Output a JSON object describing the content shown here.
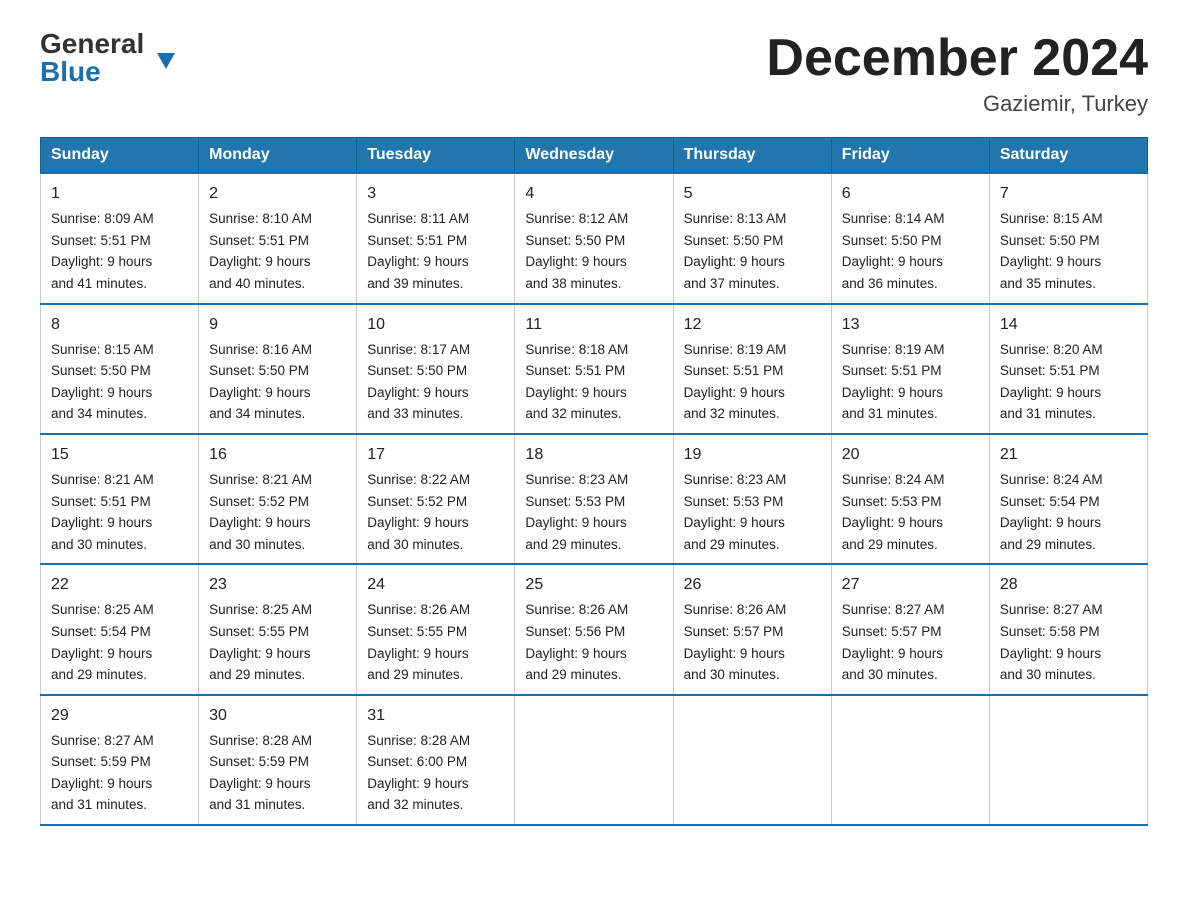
{
  "header": {
    "logo": {
      "general": "General",
      "blue": "Blue",
      "triangle": true
    },
    "title": "December 2024",
    "location": "Gaziemir, Turkey"
  },
  "calendar": {
    "days_of_week": [
      "Sunday",
      "Monday",
      "Tuesday",
      "Wednesday",
      "Thursday",
      "Friday",
      "Saturday"
    ],
    "weeks": [
      [
        {
          "day": "1",
          "sunrise": "8:09 AM",
          "sunset": "5:51 PM",
          "daylight": "9 hours and 41 minutes."
        },
        {
          "day": "2",
          "sunrise": "8:10 AM",
          "sunset": "5:51 PM",
          "daylight": "9 hours and 40 minutes."
        },
        {
          "day": "3",
          "sunrise": "8:11 AM",
          "sunset": "5:51 PM",
          "daylight": "9 hours and 39 minutes."
        },
        {
          "day": "4",
          "sunrise": "8:12 AM",
          "sunset": "5:50 PM",
          "daylight": "9 hours and 38 minutes."
        },
        {
          "day": "5",
          "sunrise": "8:13 AM",
          "sunset": "5:50 PM",
          "daylight": "9 hours and 37 minutes."
        },
        {
          "day": "6",
          "sunrise": "8:14 AM",
          "sunset": "5:50 PM",
          "daylight": "9 hours and 36 minutes."
        },
        {
          "day": "7",
          "sunrise": "8:15 AM",
          "sunset": "5:50 PM",
          "daylight": "9 hours and 35 minutes."
        }
      ],
      [
        {
          "day": "8",
          "sunrise": "8:15 AM",
          "sunset": "5:50 PM",
          "daylight": "9 hours and 34 minutes."
        },
        {
          "day": "9",
          "sunrise": "8:16 AM",
          "sunset": "5:50 PM",
          "daylight": "9 hours and 34 minutes."
        },
        {
          "day": "10",
          "sunrise": "8:17 AM",
          "sunset": "5:50 PM",
          "daylight": "9 hours and 33 minutes."
        },
        {
          "day": "11",
          "sunrise": "8:18 AM",
          "sunset": "5:51 PM",
          "daylight": "9 hours and 32 minutes."
        },
        {
          "day": "12",
          "sunrise": "8:19 AM",
          "sunset": "5:51 PM",
          "daylight": "9 hours and 32 minutes."
        },
        {
          "day": "13",
          "sunrise": "8:19 AM",
          "sunset": "5:51 PM",
          "daylight": "9 hours and 31 minutes."
        },
        {
          "day": "14",
          "sunrise": "8:20 AM",
          "sunset": "5:51 PM",
          "daylight": "9 hours and 31 minutes."
        }
      ],
      [
        {
          "day": "15",
          "sunrise": "8:21 AM",
          "sunset": "5:51 PM",
          "daylight": "9 hours and 30 minutes."
        },
        {
          "day": "16",
          "sunrise": "8:21 AM",
          "sunset": "5:52 PM",
          "daylight": "9 hours and 30 minutes."
        },
        {
          "day": "17",
          "sunrise": "8:22 AM",
          "sunset": "5:52 PM",
          "daylight": "9 hours and 30 minutes."
        },
        {
          "day": "18",
          "sunrise": "8:23 AM",
          "sunset": "5:53 PM",
          "daylight": "9 hours and 29 minutes."
        },
        {
          "day": "19",
          "sunrise": "8:23 AM",
          "sunset": "5:53 PM",
          "daylight": "9 hours and 29 minutes."
        },
        {
          "day": "20",
          "sunrise": "8:24 AM",
          "sunset": "5:53 PM",
          "daylight": "9 hours and 29 minutes."
        },
        {
          "day": "21",
          "sunrise": "8:24 AM",
          "sunset": "5:54 PM",
          "daylight": "9 hours and 29 minutes."
        }
      ],
      [
        {
          "day": "22",
          "sunrise": "8:25 AM",
          "sunset": "5:54 PM",
          "daylight": "9 hours and 29 minutes."
        },
        {
          "day": "23",
          "sunrise": "8:25 AM",
          "sunset": "5:55 PM",
          "daylight": "9 hours and 29 minutes."
        },
        {
          "day": "24",
          "sunrise": "8:26 AM",
          "sunset": "5:55 PM",
          "daylight": "9 hours and 29 minutes."
        },
        {
          "day": "25",
          "sunrise": "8:26 AM",
          "sunset": "5:56 PM",
          "daylight": "9 hours and 29 minutes."
        },
        {
          "day": "26",
          "sunrise": "8:26 AM",
          "sunset": "5:57 PM",
          "daylight": "9 hours and 30 minutes."
        },
        {
          "day": "27",
          "sunrise": "8:27 AM",
          "sunset": "5:57 PM",
          "daylight": "9 hours and 30 minutes."
        },
        {
          "day": "28",
          "sunrise": "8:27 AM",
          "sunset": "5:58 PM",
          "daylight": "9 hours and 30 minutes."
        }
      ],
      [
        {
          "day": "29",
          "sunrise": "8:27 AM",
          "sunset": "5:59 PM",
          "daylight": "9 hours and 31 minutes."
        },
        {
          "day": "30",
          "sunrise": "8:28 AM",
          "sunset": "5:59 PM",
          "daylight": "9 hours and 31 minutes."
        },
        {
          "day": "31",
          "sunrise": "8:28 AM",
          "sunset": "6:00 PM",
          "daylight": "9 hours and 32 minutes."
        },
        null,
        null,
        null,
        null
      ]
    ],
    "labels": {
      "sunrise": "Sunrise:",
      "sunset": "Sunset:",
      "daylight": "Daylight:"
    }
  }
}
